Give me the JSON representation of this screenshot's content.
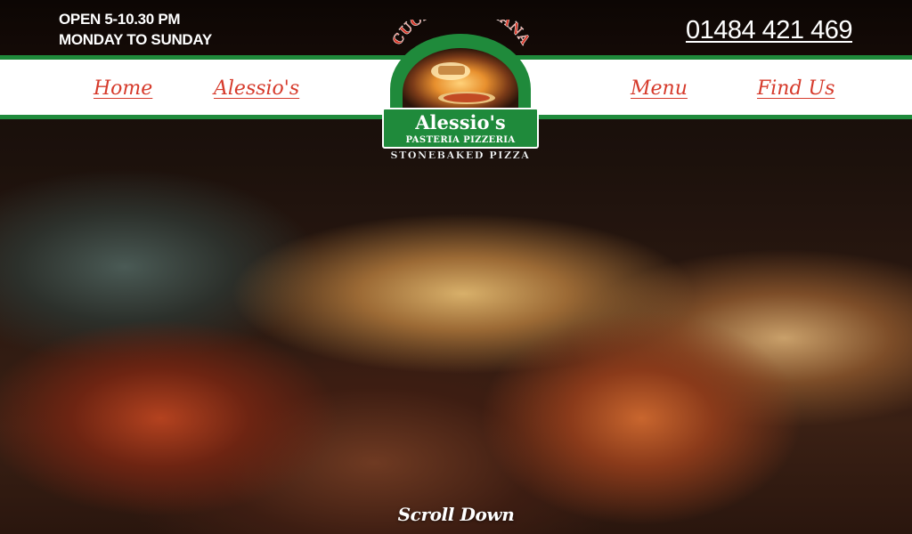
{
  "header": {
    "hours_line1": "OPEN 5-10.30 PM",
    "hours_line2": "MONDAY TO SUNDAY",
    "phone": "01484 421 469"
  },
  "nav": {
    "items": [
      {
        "label": "Home"
      },
      {
        "label": "Alessio's"
      },
      {
        "label": "Menu"
      },
      {
        "label": "Find Us"
      }
    ]
  },
  "logo": {
    "arc_text": "CUCINA ITALIANA",
    "name": "Alessio's",
    "subtitle": "PASTERIA PIZZERIA",
    "tagline": "STONEBAKED PIZZA"
  },
  "hero": {
    "scroll_label": "Scroll Down"
  },
  "colors": {
    "accent_red": "#d63a2b",
    "accent_green": "#1f8a3b",
    "header_bg": "#120a07"
  },
  "icons": {
    "logo": "pizza-oven-emblem"
  }
}
